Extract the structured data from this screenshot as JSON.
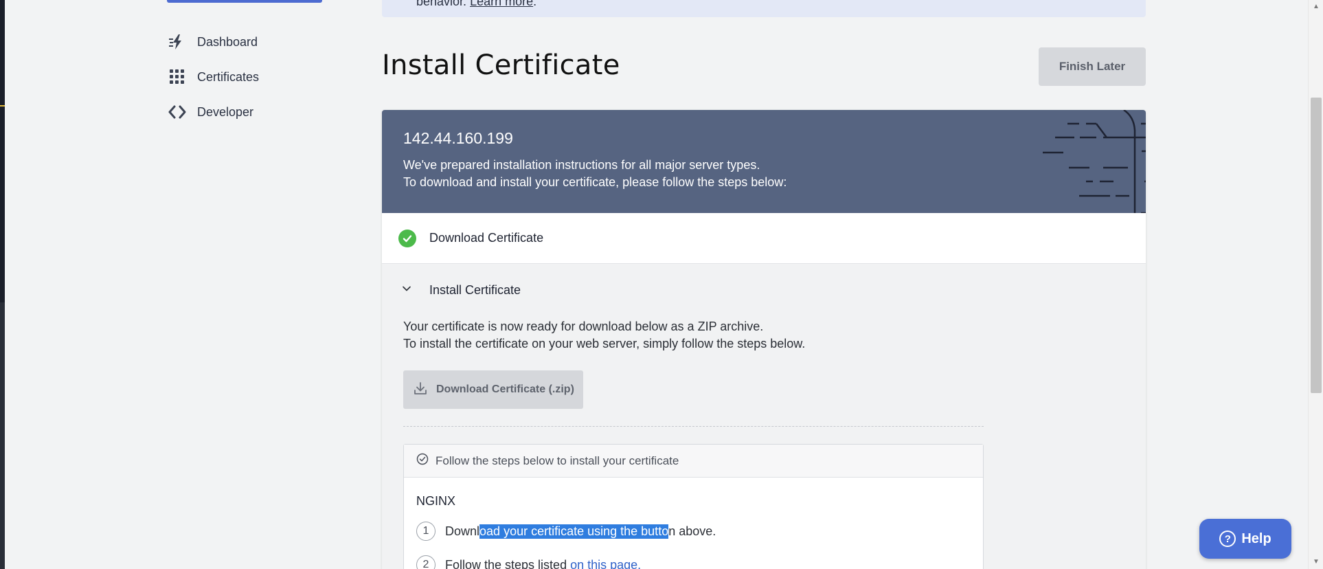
{
  "banner": {
    "prefix": "behavior. ",
    "link": "Learn more",
    "suffix": "."
  },
  "sidebar": {
    "items": [
      {
        "label": "Dashboard",
        "icon": "lightning-icon"
      },
      {
        "label": "Certificates",
        "icon": "grid-icon"
      },
      {
        "label": "Developer",
        "icon": "code-icon"
      }
    ]
  },
  "page": {
    "title": "Install Certificate",
    "finish_later": "Finish Later"
  },
  "card": {
    "ip": "142.44.160.199",
    "line1": "We've prepared installation instructions for all major server types.",
    "line2": "To download and install your certificate, please follow the steps below:"
  },
  "steps": {
    "download_label": "Download Certificate",
    "install_label": "Install Certificate",
    "desc1": "Your certificate is now ready for download below as a ZIP archive.",
    "desc2": "To install the certificate on your web server, simply follow the steps below.",
    "download_zip": "Download Certificate (.zip)"
  },
  "instructions": {
    "header": "Follow the steps below to install your certificate",
    "server": "NGINX",
    "items": [
      {
        "num": "1",
        "pre": "Downl",
        "highlight": "oad your certificate using the butto",
        "post": "n above."
      },
      {
        "num": "2",
        "pre": "Follow the steps listed ",
        "link": "on this page",
        "post": "."
      }
    ]
  },
  "help": {
    "label": "Help"
  },
  "colors": {
    "primary": "#4a6fd6",
    "header_bg": "#566481",
    "success": "#4cba4a",
    "selection": "#2f7ddf"
  }
}
